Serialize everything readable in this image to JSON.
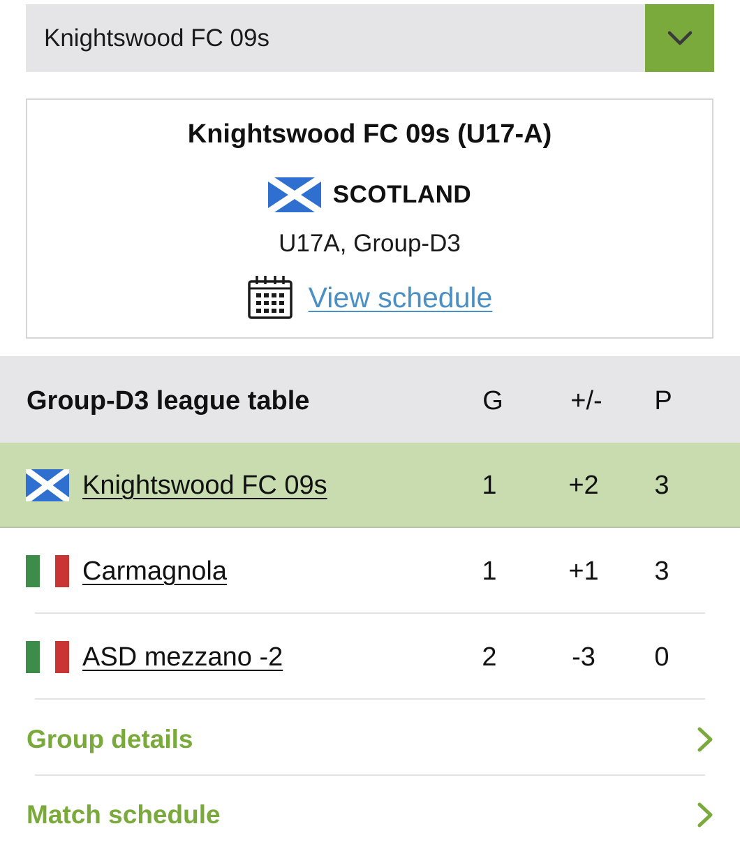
{
  "team_select": {
    "value": "Knightswood FC 09s",
    "icon": "chevron-down-icon"
  },
  "team_card": {
    "title": "Knightswood FC 09s (U17-A)",
    "country": "SCOTLAND",
    "country_flag": "scotland-flag",
    "group": "U17A, Group-D3",
    "schedule_link": "View schedule",
    "schedule_icon": "calendar-icon"
  },
  "league_table": {
    "title": "Group-D3 league table",
    "columns": {
      "g": "G",
      "gd": "+/-",
      "p": "P"
    },
    "rows": [
      {
        "team": "Knightswood FC 09s",
        "flag": "scotland-flag",
        "g": "1",
        "gd": "+2",
        "p": "3",
        "highlighted": true
      },
      {
        "team": "Carmagnola",
        "flag": "italy-flag",
        "g": "1",
        "gd": "+1",
        "p": "3",
        "highlighted": false
      },
      {
        "team": "ASD mezzano -2",
        "flag": "italy-flag",
        "g": "2",
        "gd": "-3",
        "p": "0",
        "highlighted": false
      }
    ]
  },
  "links": [
    {
      "label": "Group details",
      "icon": "chevron-right-icon"
    },
    {
      "label": "Match schedule",
      "icon": "chevron-right-icon"
    }
  ],
  "colors": {
    "accent_green": "#7aaa3c",
    "highlight_row": "#c8dcb0",
    "header_gray": "#e6e6e8",
    "link_blue": "#4a90c4",
    "scotland_blue": "#2f6fd0",
    "italy_green": "#3d8c4a",
    "italy_red": "#c93434"
  }
}
